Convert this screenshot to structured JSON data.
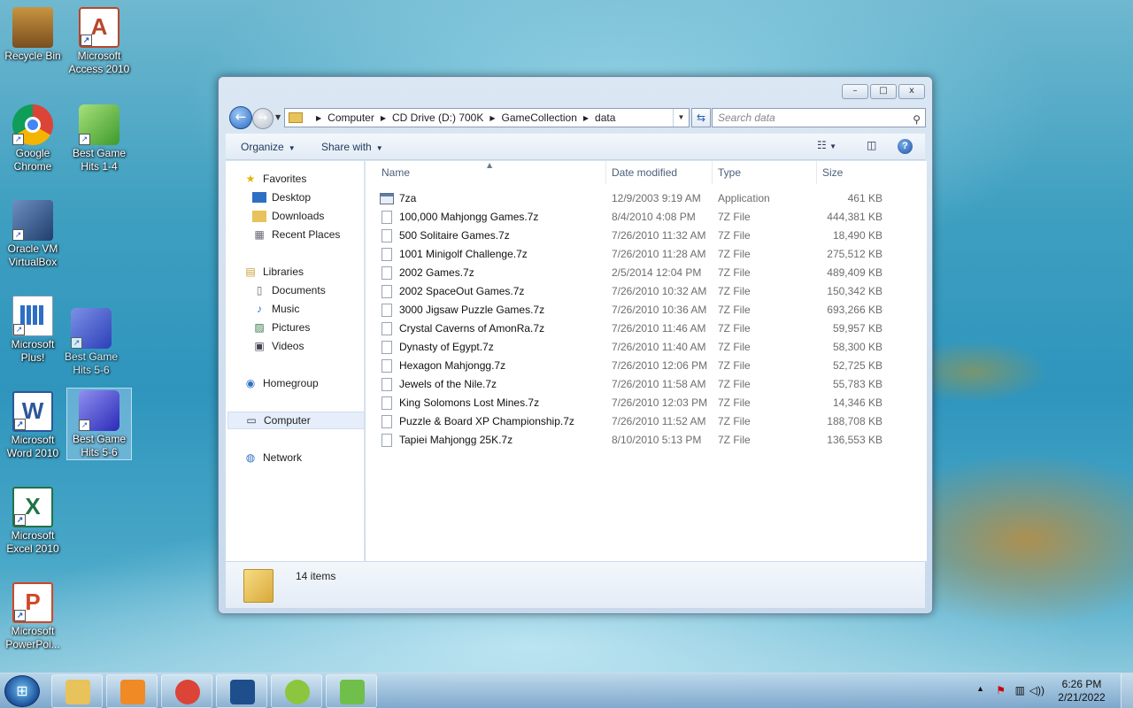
{
  "desktop": {
    "icons": [
      {
        "label": "Recycle Bin",
        "color": "#8a5a2b"
      },
      {
        "label": "Microsoft Access 2010",
        "color": "#b7472a"
      },
      {
        "label": "Google Chrome",
        "color": "#db4437"
      },
      {
        "label": "Best Game Hits 1-4",
        "color": "#4caf50"
      },
      {
        "label": "Oracle VM VirtualBox",
        "color": "#1f4e8c"
      },
      {
        "label": "Microsoft Plus!",
        "color": "#2d6fc4"
      },
      {
        "label": "Best Game Hits 5-6",
        "color": "#3a3ad0"
      },
      {
        "label": "Microsoft Word 2010",
        "color": "#2b579a"
      },
      {
        "label": "Best Game Hits 5-6",
        "color": "#3a3ad0"
      },
      {
        "label": "Microsoft Excel 2010",
        "color": "#217346"
      },
      {
        "label": "Microsoft PowerPoi...",
        "color": "#d24726"
      }
    ]
  },
  "window": {
    "caption": {
      "minimize": "–",
      "maximize": "□",
      "close": "x"
    },
    "breadcrumb": [
      "Computer",
      "CD Drive (D:) 700K",
      "GameCollection",
      "data"
    ],
    "search_placeholder": "Search data",
    "toolbar": {
      "organize": "Organize",
      "share_with": "Share with"
    },
    "nav": {
      "favorites": "Favorites",
      "desktop": "Desktop",
      "downloads": "Downloads",
      "recent_places": "Recent Places",
      "libraries": "Libraries",
      "documents": "Documents",
      "music": "Music",
      "pictures": "Pictures",
      "videos": "Videos",
      "homegroup": "Homegroup",
      "computer": "Computer",
      "network": "Network"
    },
    "columns": {
      "name": "Name",
      "date": "Date modified",
      "type": "Type",
      "size": "Size"
    },
    "files": [
      {
        "name": "7za",
        "date": "12/9/2003 9:19 AM",
        "type": "Application",
        "size": "461 KB",
        "icon": "app"
      },
      {
        "name": "100,000 Mahjongg Games.7z",
        "date": "8/4/2010 4:08 PM",
        "type": "7Z File",
        "size": "444,381 KB",
        "icon": "file"
      },
      {
        "name": "500 Solitaire Games.7z",
        "date": "7/26/2010 11:32 AM",
        "type": "7Z File",
        "size": "18,490 KB",
        "icon": "file"
      },
      {
        "name": "1001 Minigolf Challenge.7z",
        "date": "7/26/2010 11:28 AM",
        "type": "7Z File",
        "size": "275,512 KB",
        "icon": "file"
      },
      {
        "name": "2002 Games.7z",
        "date": "2/5/2014 12:04 PM",
        "type": "7Z File",
        "size": "489,409 KB",
        "icon": "file"
      },
      {
        "name": "2002 SpaceOut Games.7z",
        "date": "7/26/2010 10:32 AM",
        "type": "7Z File",
        "size": "150,342 KB",
        "icon": "file"
      },
      {
        "name": "3000 Jigsaw Puzzle Games.7z",
        "date": "7/26/2010 10:36 AM",
        "type": "7Z File",
        "size": "693,266 KB",
        "icon": "file"
      },
      {
        "name": "Crystal Caverns of AmonRa.7z",
        "date": "7/26/2010 11:46 AM",
        "type": "7Z File",
        "size": "59,957 KB",
        "icon": "file"
      },
      {
        "name": "Dynasty of Egypt.7z",
        "date": "7/26/2010 11:40 AM",
        "type": "7Z File",
        "size": "58,300 KB",
        "icon": "file"
      },
      {
        "name": "Hexagon Mahjongg.7z",
        "date": "7/26/2010 12:06 PM",
        "type": "7Z File",
        "size": "52,725 KB",
        "icon": "file"
      },
      {
        "name": "Jewels of the Nile.7z",
        "date": "7/26/2010 11:58 AM",
        "type": "7Z File",
        "size": "55,783 KB",
        "icon": "file"
      },
      {
        "name": "King Solomons Lost Mines.7z",
        "date": "7/26/2010 12:03 PM",
        "type": "7Z File",
        "size": "14,346 KB",
        "icon": "file"
      },
      {
        "name": "Puzzle & Board XP Championship.7z",
        "date": "7/26/2010 11:52 AM",
        "type": "7Z File",
        "size": "188,708 KB",
        "icon": "file"
      },
      {
        "name": "Tapiei Mahjongg 25K.7z",
        "date": "8/10/2010 5:13 PM",
        "type": "7Z File",
        "size": "136,553 KB",
        "icon": "file"
      }
    ],
    "details": {
      "items_count": "14 items"
    }
  },
  "taskbar": {
    "apps": [
      {
        "name": "Windows Explorer",
        "color": "#e8c25a"
      },
      {
        "name": "Media Player",
        "color": "#f08a24"
      },
      {
        "name": "Google Chrome",
        "color": "#db4437"
      },
      {
        "name": "VirtualBox",
        "color": "#1f4e8c"
      },
      {
        "name": "S app",
        "color": "#8cc63f"
      },
      {
        "name": "Recycle app",
        "color": "#6fbf4a"
      }
    ],
    "clock": {
      "time": "6:26 PM",
      "date": "2/21/2022"
    }
  }
}
